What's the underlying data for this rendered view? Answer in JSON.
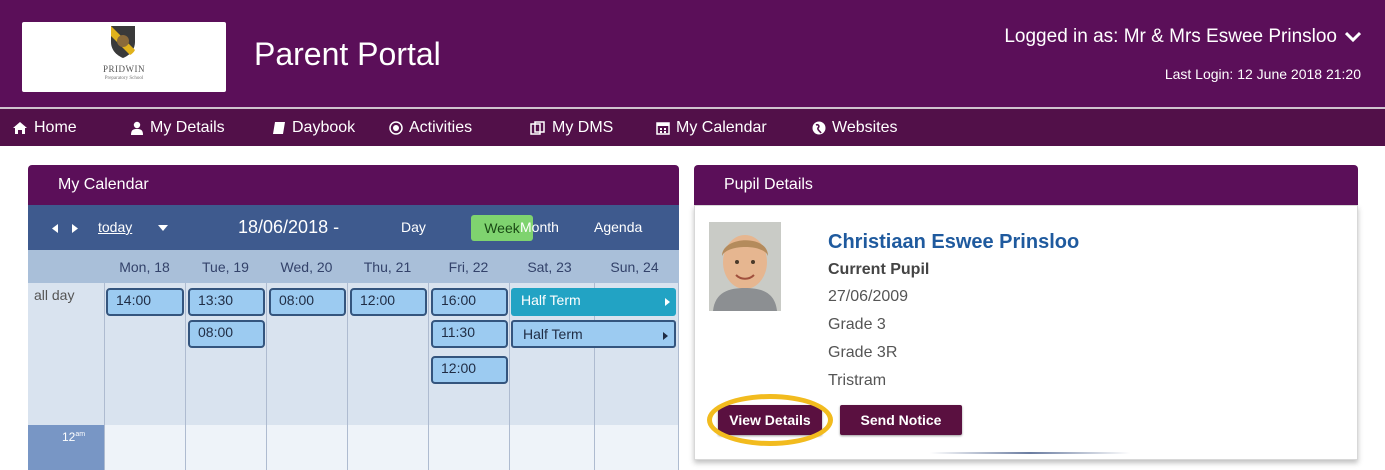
{
  "header": {
    "logo_name": "PRIDWIN",
    "logo_sub": "Preparatory School",
    "title": "Parent Portal",
    "logged_in": "Logged in as: Mr & Mrs Eswee Prinsloo",
    "last_login": "Last Login: 12 June 2018 21:20"
  },
  "nav": [
    {
      "label": "Home",
      "icon": "home-icon"
    },
    {
      "label": "My Details",
      "icon": "user-icon"
    },
    {
      "label": "Daybook",
      "icon": "book-icon"
    },
    {
      "label": "Activities",
      "icon": "dot-circle-icon"
    },
    {
      "label": "My DMS",
      "icon": "files-icon"
    },
    {
      "label": "My Calendar",
      "icon": "calendar-icon"
    },
    {
      "label": "Websites",
      "icon": "globe-icon"
    }
  ],
  "calendar": {
    "panel_title": "My Calendar",
    "today_label": "today",
    "date_range": "18/06/2018 -",
    "views": {
      "day": "Day",
      "week": "Week",
      "month": "Month",
      "agenda": "Agenda"
    },
    "active_view": "Week",
    "days": [
      "Mon, 18",
      "Tue, 19",
      "Wed, 20",
      "Thu, 21",
      "Fri, 22",
      "Sat, 23",
      "Sun, 24"
    ],
    "allday_label": "all day",
    "time_label": "12",
    "time_suffix": "am",
    "events": [
      {
        "day": "Mon, 18",
        "time": "14:00"
      },
      {
        "day": "Tue, 19",
        "time": "13:30"
      },
      {
        "day": "Tue, 19",
        "time": "08:00"
      },
      {
        "day": "Wed, 20",
        "time": "08:00"
      },
      {
        "day": "Thu, 21",
        "time": "12:00"
      },
      {
        "day": "Fri, 22",
        "time": "16:00"
      },
      {
        "day": "Fri, 22",
        "time": "11:30"
      },
      {
        "day": "Fri, 22",
        "time": "12:00"
      }
    ],
    "half_terms": [
      {
        "label": "Half Term",
        "color": "#22a3c4"
      },
      {
        "label": "Half Term",
        "color": "#9ccbf1"
      }
    ]
  },
  "pupil": {
    "panel_title": "Pupil Details",
    "name": "Christiaan Eswee Prinsloo",
    "status": "Current Pupil",
    "dob": "27/06/2009",
    "grade": "Grade 3",
    "class": "Grade 3R",
    "house": "Tristram",
    "view_button": "View Details",
    "notice_button": "Send Notice"
  },
  "colors": {
    "header_bg": "#5b0f59",
    "nav_bg": "#521049",
    "toolbar_bg": "#3e5a8e",
    "week_active": "#7fd36f",
    "highlight": "#f2bb1e"
  }
}
